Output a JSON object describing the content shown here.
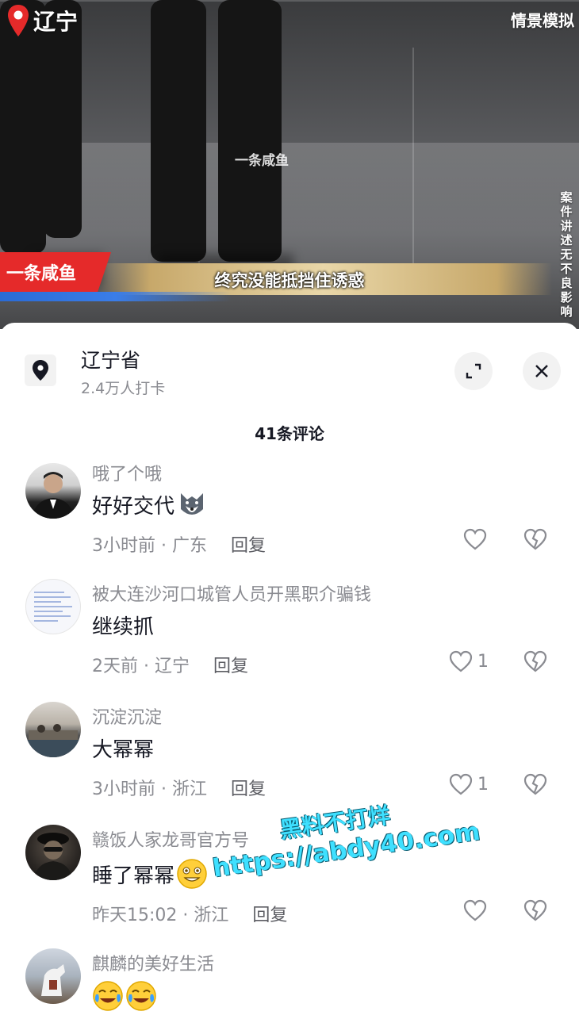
{
  "video": {
    "location_tag": "辽宁",
    "scene_label": "情景模拟",
    "center_watermark": "一条咸鱼",
    "side_notice": "案件讲述 无不良影响",
    "brand_tag": "一条咸鱼",
    "subtitle": "终究没能抵挡住诱惑"
  },
  "place": {
    "name": "辽宁省",
    "checkins": "2.4万人打卡"
  },
  "comments_count": "41条评论",
  "comments": [
    {
      "user": "哦了个哦",
      "text": "好好交代",
      "time": "3小时前",
      "region": "广东",
      "reply": "回复",
      "likes": ""
    },
    {
      "user": "被大连沙河口城管人员开黑职介骗钱",
      "text": "继续抓",
      "time": "2天前",
      "region": "辽宁",
      "reply": "回复",
      "likes": "1"
    },
    {
      "user": "沉淀沉淀",
      "text": "大幂幂",
      "time": "3小时前",
      "region": "浙江",
      "reply": "回复",
      "likes": "1"
    },
    {
      "user": "赣饭人家龙哥官方号",
      "text": "睡了幂幂",
      "time": "昨天15:02",
      "region": "浙江",
      "reply": "回复",
      "likes": ""
    },
    {
      "user": "麒麟的美好生活",
      "text": "",
      "time": "",
      "region": "",
      "reply": "",
      "likes": ""
    }
  ],
  "overlay_watermark": {
    "line1": "黑料不打烊",
    "line2": "https://abdy40.com"
  },
  "colors": {
    "brand_red": "#e52a2a",
    "gold": "#e9d7a8",
    "watermark": "#3fe0ff"
  }
}
